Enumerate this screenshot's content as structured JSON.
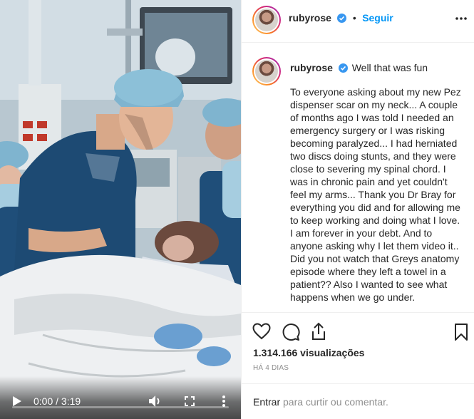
{
  "post": {
    "username": "rubyrose",
    "follow_label": "Seguir",
    "separator": "•",
    "caption_title": "Well that was fun",
    "caption_body": "To everyone asking about my new Pez dispenser scar on my neck... A couple of months ago I was told I needed an emergency surgery or I was risking becoming paralyzed... I had herniated two discs doing stunts, and they were close to severing my spinal chord. I was in chronic pain and yet couldn't feel my arms... Thank you Dr Bray for everything you did and for allowing me to keep working and doing what I love. I am forever in your debt. And to anyone asking why I let them video it.. Did you not watch that Greys anatomy episode where they left a towel in a patient?? Also I wanted to see what happens when we go under.",
    "views": "1.314.166 visualizações",
    "date": "HÁ 4 DIAS"
  },
  "video": {
    "current_time": "0:00",
    "duration": "3:19",
    "time_separator": " / ",
    "progress_fraction": 0.0
  },
  "comment_box": {
    "login_link": "Entrar",
    "login_text": " para curtir ou comentar."
  },
  "icons": {
    "play": "play-icon",
    "volume": "volume-icon",
    "fullscreen": "fullscreen-icon",
    "more": "more-vertical-icon",
    "like": "heart-icon",
    "comment": "comment-icon",
    "share": "share-icon",
    "save": "bookmark-icon",
    "verified": "verified-badge-icon"
  },
  "colors": {
    "accent": "#0095f6",
    "text": "#262626",
    "muted": "#8e8e8e",
    "verified": "#3897f0"
  }
}
